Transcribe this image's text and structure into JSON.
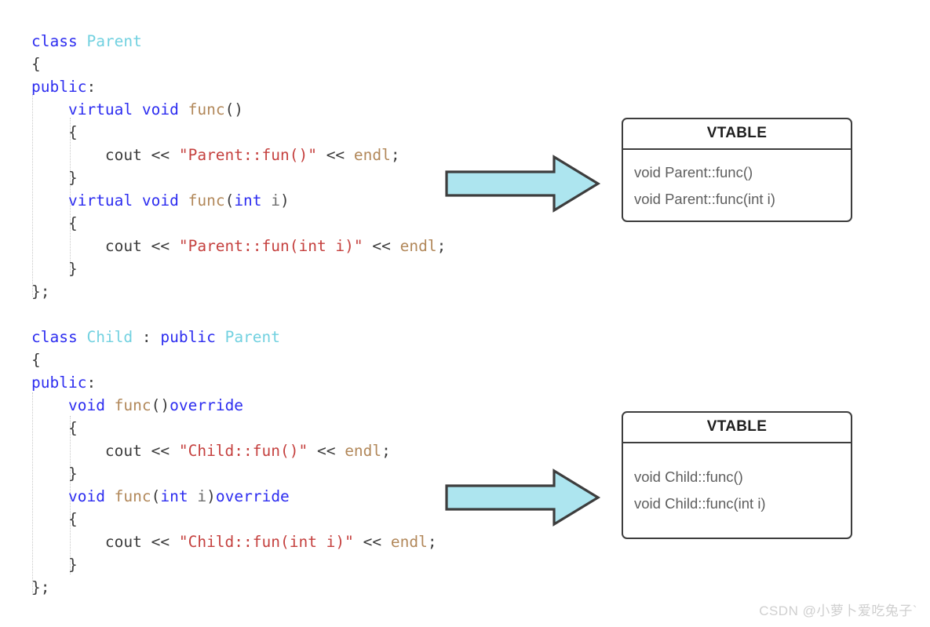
{
  "diagram": {
    "title": "C++ virtual function table (vtable) overriding illustration",
    "colors": {
      "keyword": "#2d2df0",
      "type_name": "#72d1e0",
      "function": "#b2885a",
      "string": "#c5413f",
      "punctuation": "#3c3c3c",
      "arrow_fill": "#ade5ef",
      "arrow_stroke": "#3d3d3d",
      "box_border": "#3d3d3d",
      "background": "#ffffff",
      "watermark": "#cfcfcf"
    }
  },
  "code": {
    "parent_class": {
      "lines": [
        {
          "tokens": [
            {
              "t": "class ",
              "c": "kw"
            },
            {
              "t": "Parent",
              "c": "typ"
            }
          ]
        },
        {
          "tokens": [
            {
              "t": "{",
              "c": "pun"
            }
          ]
        },
        {
          "tokens": [
            {
              "t": "public",
              "c": "kw"
            },
            {
              "t": ":",
              "c": "pun"
            }
          ]
        },
        {
          "tokens": [
            {
              "t": "    ",
              "c": "pun"
            },
            {
              "t": "virtual void ",
              "c": "kw"
            },
            {
              "t": "func",
              "c": "fn"
            },
            {
              "t": "()",
              "c": "pun"
            }
          ]
        },
        {
          "tokens": [
            {
              "t": "    {",
              "c": "pun"
            }
          ]
        },
        {
          "tokens": [
            {
              "t": "        cout << ",
              "c": "pun"
            },
            {
              "t": "\"Parent::fun()\"",
              "c": "str"
            },
            {
              "t": " << ",
              "c": "pun"
            },
            {
              "t": "endl",
              "c": "fn"
            },
            {
              "t": ";",
              "c": "pun"
            }
          ]
        },
        {
          "tokens": [
            {
              "t": "    }",
              "c": "pun"
            }
          ]
        },
        {
          "tokens": [
            {
              "t": "    ",
              "c": "pun"
            },
            {
              "t": "virtual void ",
              "c": "kw"
            },
            {
              "t": "func",
              "c": "fn"
            },
            {
              "t": "(",
              "c": "pun"
            },
            {
              "t": "int",
              "c": "kw"
            },
            {
              "t": " ",
              "c": "pun"
            },
            {
              "t": "i",
              "c": "var"
            },
            {
              "t": ")",
              "c": "pun"
            }
          ]
        },
        {
          "tokens": [
            {
              "t": "    {",
              "c": "pun"
            }
          ]
        },
        {
          "tokens": [
            {
              "t": "        cout << ",
              "c": "pun"
            },
            {
              "t": "\"Parent::fun(int i)\"",
              "c": "str"
            },
            {
              "t": " << ",
              "c": "pun"
            },
            {
              "t": "endl",
              "c": "fn"
            },
            {
              "t": ";",
              "c": "pun"
            }
          ]
        },
        {
          "tokens": [
            {
              "t": "    }",
              "c": "pun"
            }
          ]
        },
        {
          "tokens": [
            {
              "t": "};",
              "c": "pun"
            }
          ]
        }
      ]
    },
    "child_class": {
      "lines": [
        {
          "tokens": [
            {
              "t": "class ",
              "c": "kw"
            },
            {
              "t": "Child",
              "c": "typ"
            },
            {
              "t": " : ",
              "c": "pun"
            },
            {
              "t": "public ",
              "c": "kw"
            },
            {
              "t": "Parent",
              "c": "typ"
            }
          ]
        },
        {
          "tokens": [
            {
              "t": "{",
              "c": "pun"
            }
          ]
        },
        {
          "tokens": [
            {
              "t": "public",
              "c": "kw"
            },
            {
              "t": ":",
              "c": "pun"
            }
          ]
        },
        {
          "tokens": [
            {
              "t": "    ",
              "c": "pun"
            },
            {
              "t": "void ",
              "c": "kw"
            },
            {
              "t": "func",
              "c": "fn"
            },
            {
              "t": "()",
              "c": "pun"
            },
            {
              "t": "override",
              "c": "kw"
            }
          ]
        },
        {
          "tokens": [
            {
              "t": "    {",
              "c": "pun"
            }
          ]
        },
        {
          "tokens": [
            {
              "t": "        cout << ",
              "c": "pun"
            },
            {
              "t": "\"Child::fun()\"",
              "c": "str"
            },
            {
              "t": " << ",
              "c": "pun"
            },
            {
              "t": "endl",
              "c": "fn"
            },
            {
              "t": ";",
              "c": "pun"
            }
          ]
        },
        {
          "tokens": [
            {
              "t": "    }",
              "c": "pun"
            }
          ]
        },
        {
          "tokens": [
            {
              "t": "    ",
              "c": "pun"
            },
            {
              "t": "void ",
              "c": "kw"
            },
            {
              "t": "func",
              "c": "fn"
            },
            {
              "t": "(",
              "c": "pun"
            },
            {
              "t": "int",
              "c": "kw"
            },
            {
              "t": " ",
              "c": "pun"
            },
            {
              "t": "i",
              "c": "var"
            },
            {
              "t": ")",
              "c": "pun"
            },
            {
              "t": "override",
              "c": "kw"
            }
          ]
        },
        {
          "tokens": [
            {
              "t": "    {",
              "c": "pun"
            }
          ]
        },
        {
          "tokens": [
            {
              "t": "        cout << ",
              "c": "pun"
            },
            {
              "t": "\"Child::fun(int i)\"",
              "c": "str"
            },
            {
              "t": " << ",
              "c": "pun"
            },
            {
              "t": "endl",
              "c": "fn"
            },
            {
              "t": ";",
              "c": "pun"
            }
          ]
        },
        {
          "tokens": [
            {
              "t": "    }",
              "c": "pun"
            }
          ]
        },
        {
          "tokens": [
            {
              "t": "};",
              "c": "pun"
            }
          ]
        }
      ]
    },
    "gap_lines": 1
  },
  "vtables": [
    {
      "id": "parent",
      "title": "VTABLE",
      "entries": [
        "void Parent::func()",
        "void Parent::func(int i)"
      ]
    },
    {
      "id": "child",
      "title": "VTABLE",
      "entries": [
        "void Child::func()",
        "void Child::func(int i)"
      ]
    }
  ],
  "arrows": [
    {
      "id": "parent-arrow",
      "direction": "right",
      "label": ""
    },
    {
      "id": "child-arrow",
      "direction": "right",
      "label": ""
    }
  ],
  "watermark": {
    "text": "CSDN @小萝卜爱吃兔子`"
  }
}
